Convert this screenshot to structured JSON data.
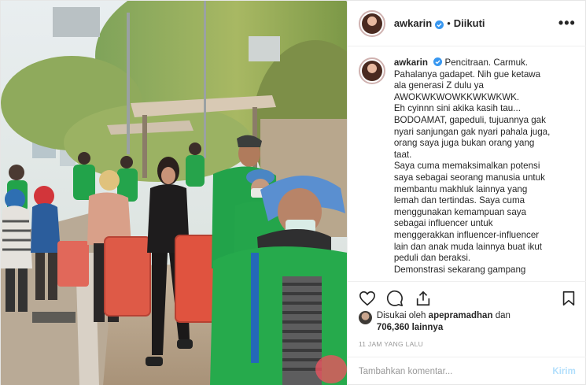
{
  "post": {
    "username": "awkarin",
    "follow_state": "Diikuti",
    "caption_lines": [
      "Pencitraan. Carmuk.",
      "Pahalanya gadapet. Nih gue ketawa",
      "ala generasi Z dulu ya",
      "AWOKWKWOWKKWKWKWK.",
      "Eh cyinnn sini akika kasih tau...",
      "BODOAMAT, gapeduli, tujuannya gak",
      "nyari sanjungan gak nyari pahala juga,",
      "orang saya juga bukan orang yang",
      "taat.",
      "Saya cuma memaksimalkan potensi",
      "saya sebagai seorang manusia untuk",
      "membantu makhluk lainnya yang",
      "lemah dan tertindas. Saya cuma",
      "menggunakan kemampuan saya",
      "sebagai influencer untuk",
      "menggerakkan influencer-influencer",
      "lain dan anak muda lainnya buat ikut",
      "peduli dan beraksi.",
      "Demonstrasi sekarang gampang"
    ],
    "likes": {
      "prefix": "Disukai oleh",
      "liked_by": "apepramadhan",
      "conjunction": "dan",
      "count": "706,360",
      "suffix": "lainnya"
    },
    "timestamp": "11 JAM YANG LALU",
    "comment_placeholder": "Tambahkan komentar...",
    "post_button": "Kirim"
  },
  "icons": {
    "verified": "verified-badge-icon",
    "more": "more-options-icon",
    "like": "heart-icon",
    "comment": "comment-bubble-icon",
    "share": "share-icon",
    "save": "bookmark-icon"
  },
  "colors": {
    "verified": "#3897f0",
    "jacket_green": "#22a34a",
    "post_button": "#b2dffc"
  }
}
